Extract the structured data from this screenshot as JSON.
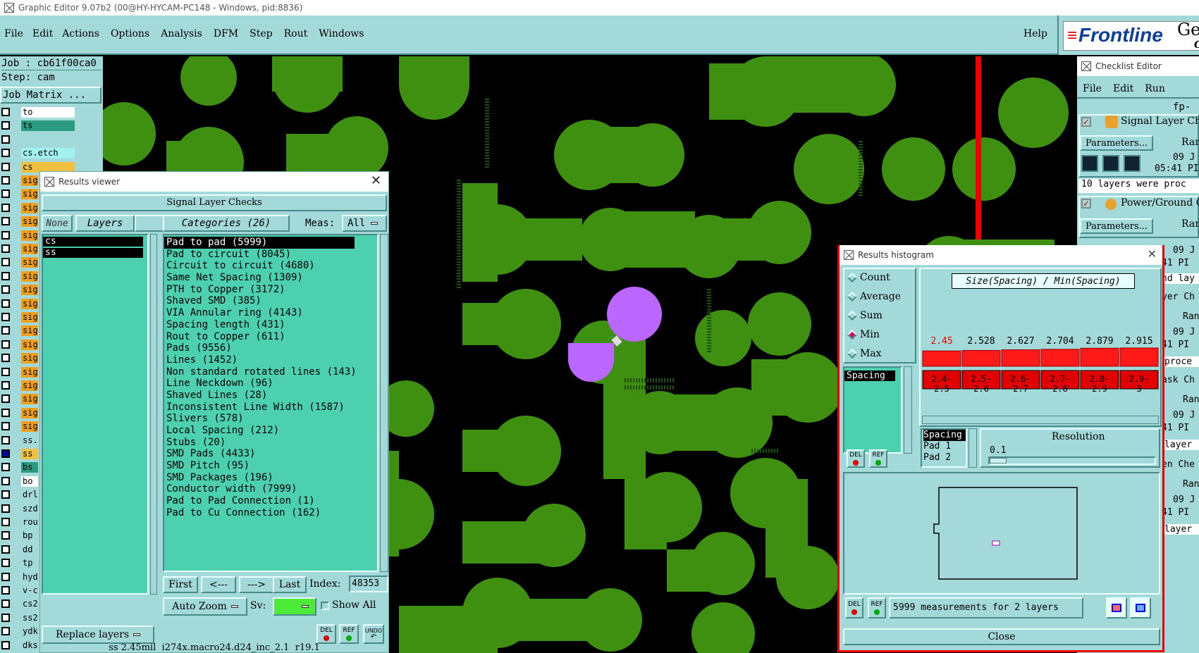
{
  "app": {
    "title": "Graphic Editor 9.07b2 (00@HY-HYCAM-PC148 - Windows, pid:8836)"
  },
  "menu": {
    "items": [
      "File",
      "Edit",
      "Actions",
      "Options",
      "Analysis",
      "DFM",
      "Step",
      "Rout",
      "Windows"
    ],
    "help": "Help"
  },
  "brand": {
    "name": "Frontline",
    "cut": "Ger",
    "cut2": "G"
  },
  "job": {
    "job": "Job : cb61f00ca0",
    "step": "Step: cam",
    "matrix_btn": "Job Matrix ..."
  },
  "layers": [
    "to",
    "ts",
    "",
    "cs.etch",
    "cs",
    "sig",
    "sig",
    "sig",
    "sig",
    "sig",
    "sig",
    "sig",
    "sig",
    "sig",
    "sig",
    "sig",
    "sig",
    "sig",
    "sig",
    "sig",
    "sig",
    "sig",
    "sig",
    "sig",
    "ss.",
    "ss",
    "bs",
    "bo",
    "drl",
    "szd",
    "rou",
    "bp",
    "dd",
    "tp",
    "hyd",
    "v-c",
    "cs2",
    "ss2",
    "ydk",
    "dks"
  ],
  "results_viewer": {
    "title": "Results viewer",
    "header": "Signal Layer Checks",
    "none": "None",
    "layers": "Layers",
    "all": "All",
    "categories_btn": "Categories (26)",
    "meas_label": "Meas:",
    "meas_value": "All",
    "layer_list": [
      "cs",
      "ss"
    ],
    "categories": [
      "Pad to pad (5999)",
      "Pad to circuit (8045)",
      "Circuit to circuit (4680)",
      "Same Net Spacing (1309)",
      "PTH to Copper (3172)",
      "Shaved SMD (385)",
      "VIA Annular ring (4143)",
      "Spacing length (431)",
      "Rout to Copper (611)",
      "Pads (9556)",
      "Lines (1452)",
      "Non standard rotated lines (143)",
      "Line Neckdown (96)",
      "Shaved Lines (28)",
      "Inconsistent Line Width (1587)",
      "Slivers (578)",
      "Local Spacing (212)",
      "Stubs (20)",
      "SMD Pads (4433)",
      "SMD Pitch (95)",
      "SMD Packages (196)",
      "Conductor width (7999)",
      "Pad to Pad Connection (1)",
      "Pad to Cu Connection (162)"
    ],
    "nav": {
      "first": "First",
      "prev": "<---",
      "next": "--->",
      "last": "Last",
      "index_label": "Index:",
      "index_value": "48353"
    },
    "auto_zoom": "Auto Zoom",
    "sv": "Sv:",
    "show_all": "Show All",
    "replace_layers": "Replace layers",
    "del": "DEL",
    "ref": "REF",
    "undo": "UNDO",
    "status": "ss 2.45mil  i274x.macro24.d24_inc_2.1  r19.1"
  },
  "histogram": {
    "title": "Results histogram",
    "modes": [
      "Count",
      "Average",
      "Sum",
      "Min",
      "Max"
    ],
    "selected_mode": "Min",
    "chart_title": "Size(Spacing) / Min(Spacing)",
    "list": [
      "Spacing"
    ],
    "list2": [
      "Spacing",
      "Pad 1",
      "Pad 2"
    ],
    "resolution_label": "Resolution",
    "resolution_value": "0.1",
    "footer": "5999 measurements for 2 layers",
    "close": "Close",
    "del": "DEL",
    "ref": "REF"
  },
  "chart_data": {
    "type": "bar",
    "title": "Size(Spacing) / Min(Spacing)",
    "categories": [
      "2.4-2.5",
      "2.5-2.6",
      "2.6-2.7",
      "2.7-2.8",
      "2.8-2.9",
      "2.9-3"
    ],
    "values": [
      2.45,
      2.528,
      2.627,
      2.704,
      2.879,
      2.915
    ],
    "value_labels": [
      "2.45",
      "2.528",
      "2.627",
      "2.704",
      "2.879",
      "2.915"
    ],
    "bar_color": "#ff1a1a",
    "highlight_color": "#e00000"
  },
  "checklist": {
    "title": "Checklist Editor",
    "menu": [
      "File",
      "Edit",
      "Run"
    ],
    "name": "fp-",
    "rows": [
      {
        "name": "Signal Layer Ch",
        "params": "Parameters...",
        "ran": "Ran",
        "date": "09 J",
        "time": "05:41 PI",
        "msg": "10 layers were proc"
      },
      {
        "name": "Power/Ground C",
        "params": "Parameters...",
        "ran": "Ran",
        "date": "09 J",
        "time": "41 PI",
        "msg": "nd lay"
      }
    ],
    "cut_items": [
      "yer Ch",
      "Ran",
      "09 J",
      "41 PI",
      "proce",
      "ask Ch",
      "Ran",
      "09 J",
      "41 PI",
      "layer",
      "en Che",
      "Ran",
      "09 J",
      "41 PI",
      "layer"
    ]
  },
  "colors": {
    "panel": "#a3d9d9",
    "copper": "#3f8f10",
    "highlight": "#bb66ff",
    "accent": "#00c8a0"
  }
}
